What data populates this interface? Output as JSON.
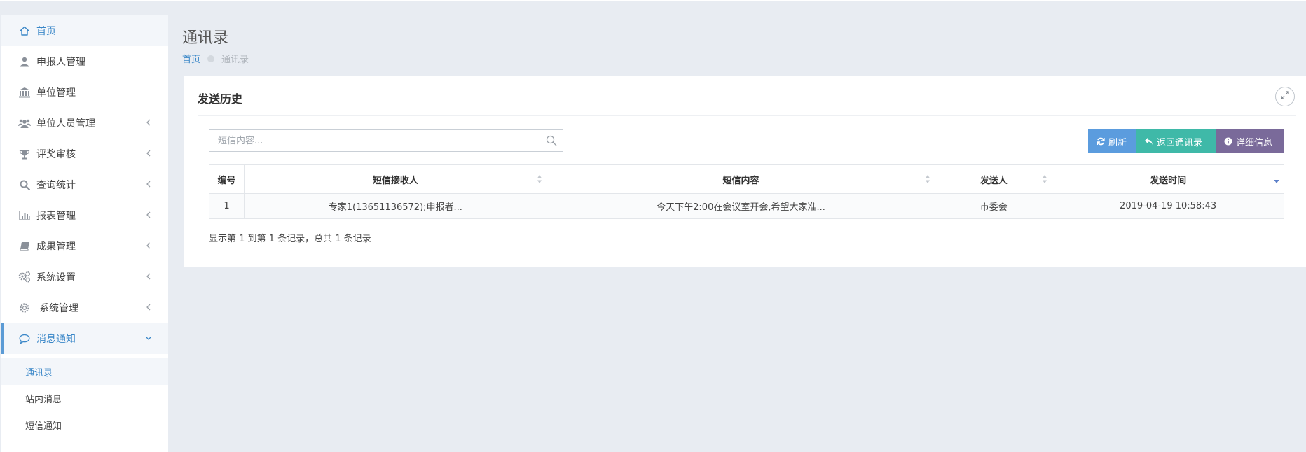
{
  "sidebar": {
    "home": {
      "label": "首页",
      "icon": "home-icon"
    },
    "items": [
      {
        "label": "申报人管理",
        "icon": "user-icon",
        "has_arrow": false
      },
      {
        "label": "单位管理",
        "icon": "bank-icon",
        "has_arrow": false
      },
      {
        "label": "单位人员管理",
        "icon": "users-icon",
        "has_arrow": true
      },
      {
        "label": "评奖审核",
        "icon": "trophy-icon",
        "has_arrow": true
      },
      {
        "label": "查询统计",
        "icon": "search-icon",
        "has_arrow": true
      },
      {
        "label": "报表管理",
        "icon": "bar-chart-icon",
        "has_arrow": true
      },
      {
        "label": "成果管理",
        "icon": "book-icon",
        "has_arrow": true
      },
      {
        "label": "系统设置",
        "icon": "gears-icon",
        "has_arrow": true
      },
      {
        "label": "系统管理",
        "icon": "gear-icon",
        "has_arrow": true
      }
    ],
    "active": {
      "label": "消息通知",
      "icon": "chat-bubble-icon"
    },
    "submenu": [
      {
        "label": "通讯录",
        "current": true
      },
      {
        "label": "站内消息",
        "current": false
      },
      {
        "label": "短信通知",
        "current": false
      }
    ]
  },
  "header": {
    "title": "通讯录",
    "breadcrumb": {
      "home": "首页",
      "current": "通讯录"
    }
  },
  "panel": {
    "title": "发送历史",
    "search_placeholder": "短信内容...",
    "buttons": {
      "refresh": "刷新",
      "back": "返回通讯录",
      "detail": "详细信息"
    },
    "table": {
      "columns": [
        "编号",
        "短信接收人",
        "短信内容",
        "发送人",
        "发送时间"
      ],
      "rows": [
        [
          "1",
          "专家1(13651136572);申报者...",
          "今天下午2:00在会议室开会,希望大家准...",
          "市委会",
          "2019-04-19 10:58:43"
        ]
      ]
    },
    "pagination_text": "显示第 1 到第 1 条记录，总共 1 条记录"
  },
  "colors": {
    "accent": "#3a87c8",
    "refresh_button": "#5b9cde",
    "back_button": "#3fb9a8",
    "detail_button": "#7a6a9a",
    "page_background": "#e8ecf2"
  }
}
